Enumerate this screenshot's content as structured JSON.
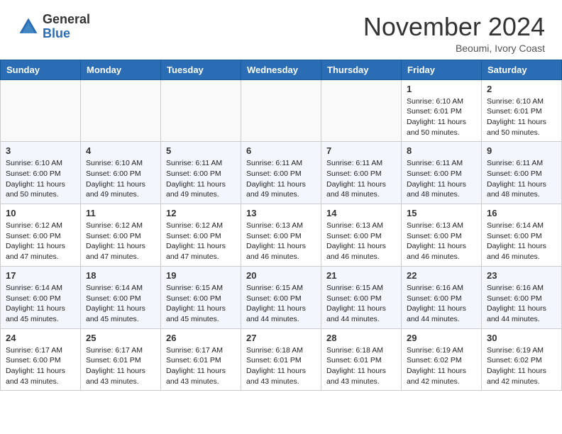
{
  "header": {
    "logo_general": "General",
    "logo_blue": "Blue",
    "month_title": "November 2024",
    "location": "Beoumi, Ivory Coast"
  },
  "weekdays": [
    "Sunday",
    "Monday",
    "Tuesday",
    "Wednesday",
    "Thursday",
    "Friday",
    "Saturday"
  ],
  "weeks": [
    [
      {
        "day": "",
        "info": ""
      },
      {
        "day": "",
        "info": ""
      },
      {
        "day": "",
        "info": ""
      },
      {
        "day": "",
        "info": ""
      },
      {
        "day": "",
        "info": ""
      },
      {
        "day": "1",
        "info": "Sunrise: 6:10 AM\nSunset: 6:01 PM\nDaylight: 11 hours\nand 50 minutes."
      },
      {
        "day": "2",
        "info": "Sunrise: 6:10 AM\nSunset: 6:01 PM\nDaylight: 11 hours\nand 50 minutes."
      }
    ],
    [
      {
        "day": "3",
        "info": "Sunrise: 6:10 AM\nSunset: 6:00 PM\nDaylight: 11 hours\nand 50 minutes."
      },
      {
        "day": "4",
        "info": "Sunrise: 6:10 AM\nSunset: 6:00 PM\nDaylight: 11 hours\nand 49 minutes."
      },
      {
        "day": "5",
        "info": "Sunrise: 6:11 AM\nSunset: 6:00 PM\nDaylight: 11 hours\nand 49 minutes."
      },
      {
        "day": "6",
        "info": "Sunrise: 6:11 AM\nSunset: 6:00 PM\nDaylight: 11 hours\nand 49 minutes."
      },
      {
        "day": "7",
        "info": "Sunrise: 6:11 AM\nSunset: 6:00 PM\nDaylight: 11 hours\nand 48 minutes."
      },
      {
        "day": "8",
        "info": "Sunrise: 6:11 AM\nSunset: 6:00 PM\nDaylight: 11 hours\nand 48 minutes."
      },
      {
        "day": "9",
        "info": "Sunrise: 6:11 AM\nSunset: 6:00 PM\nDaylight: 11 hours\nand 48 minutes."
      }
    ],
    [
      {
        "day": "10",
        "info": "Sunrise: 6:12 AM\nSunset: 6:00 PM\nDaylight: 11 hours\nand 47 minutes."
      },
      {
        "day": "11",
        "info": "Sunrise: 6:12 AM\nSunset: 6:00 PM\nDaylight: 11 hours\nand 47 minutes."
      },
      {
        "day": "12",
        "info": "Sunrise: 6:12 AM\nSunset: 6:00 PM\nDaylight: 11 hours\nand 47 minutes."
      },
      {
        "day": "13",
        "info": "Sunrise: 6:13 AM\nSunset: 6:00 PM\nDaylight: 11 hours\nand 46 minutes."
      },
      {
        "day": "14",
        "info": "Sunrise: 6:13 AM\nSunset: 6:00 PM\nDaylight: 11 hours\nand 46 minutes."
      },
      {
        "day": "15",
        "info": "Sunrise: 6:13 AM\nSunset: 6:00 PM\nDaylight: 11 hours\nand 46 minutes."
      },
      {
        "day": "16",
        "info": "Sunrise: 6:14 AM\nSunset: 6:00 PM\nDaylight: 11 hours\nand 46 minutes."
      }
    ],
    [
      {
        "day": "17",
        "info": "Sunrise: 6:14 AM\nSunset: 6:00 PM\nDaylight: 11 hours\nand 45 minutes."
      },
      {
        "day": "18",
        "info": "Sunrise: 6:14 AM\nSunset: 6:00 PM\nDaylight: 11 hours\nand 45 minutes."
      },
      {
        "day": "19",
        "info": "Sunrise: 6:15 AM\nSunset: 6:00 PM\nDaylight: 11 hours\nand 45 minutes."
      },
      {
        "day": "20",
        "info": "Sunrise: 6:15 AM\nSunset: 6:00 PM\nDaylight: 11 hours\nand 44 minutes."
      },
      {
        "day": "21",
        "info": "Sunrise: 6:15 AM\nSunset: 6:00 PM\nDaylight: 11 hours\nand 44 minutes."
      },
      {
        "day": "22",
        "info": "Sunrise: 6:16 AM\nSunset: 6:00 PM\nDaylight: 11 hours\nand 44 minutes."
      },
      {
        "day": "23",
        "info": "Sunrise: 6:16 AM\nSunset: 6:00 PM\nDaylight: 11 hours\nand 44 minutes."
      }
    ],
    [
      {
        "day": "24",
        "info": "Sunrise: 6:17 AM\nSunset: 6:00 PM\nDaylight: 11 hours\nand 43 minutes."
      },
      {
        "day": "25",
        "info": "Sunrise: 6:17 AM\nSunset: 6:01 PM\nDaylight: 11 hours\nand 43 minutes."
      },
      {
        "day": "26",
        "info": "Sunrise: 6:17 AM\nSunset: 6:01 PM\nDaylight: 11 hours\nand 43 minutes."
      },
      {
        "day": "27",
        "info": "Sunrise: 6:18 AM\nSunset: 6:01 PM\nDaylight: 11 hours\nand 43 minutes."
      },
      {
        "day": "28",
        "info": "Sunrise: 6:18 AM\nSunset: 6:01 PM\nDaylight: 11 hours\nand 43 minutes."
      },
      {
        "day": "29",
        "info": "Sunrise: 6:19 AM\nSunset: 6:02 PM\nDaylight: 11 hours\nand 42 minutes."
      },
      {
        "day": "30",
        "info": "Sunrise: 6:19 AM\nSunset: 6:02 PM\nDaylight: 11 hours\nand 42 minutes."
      }
    ]
  ]
}
